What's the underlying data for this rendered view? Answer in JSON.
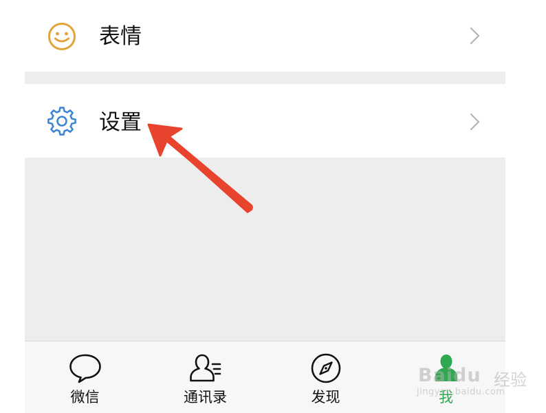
{
  "menu": {
    "items": [
      {
        "label": "表情",
        "icon": "smiley-icon",
        "icon_color": "#e0a43a"
      },
      {
        "label": "设置",
        "icon": "gear-icon",
        "icon_color": "#3d86d3"
      }
    ]
  },
  "tabbar": {
    "tabs": [
      {
        "label": "微信",
        "icon": "chat-bubble-icon"
      },
      {
        "label": "通讯录",
        "icon": "contacts-icon"
      },
      {
        "label": "发现",
        "icon": "compass-icon"
      },
      {
        "label": "我",
        "icon": "me-icon",
        "active": true
      }
    ],
    "active_color": "#2fa84f"
  },
  "annotation": {
    "arrow_color": "#e8432d"
  },
  "watermark": {
    "brand": "Baidu",
    "sub": "经验",
    "url": "jingyan.baidu.com"
  }
}
